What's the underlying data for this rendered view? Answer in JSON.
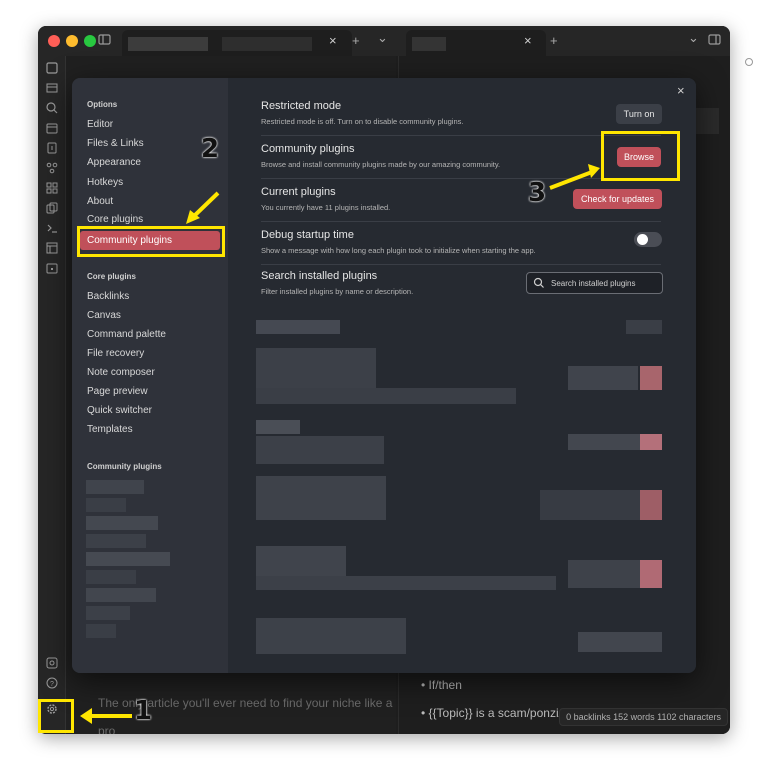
{
  "colors": {
    "accent": "#c0505a",
    "annotation": "#ffe600",
    "modal_bg": "#262a31",
    "sidebar_bg": "#2f323a"
  },
  "settings_sidebar": {
    "options_heading": "Options",
    "options_items": [
      "Editor",
      "Files & Links",
      "Appearance",
      "Hotkeys",
      "About",
      "Core plugins"
    ],
    "active_item": "Community plugins",
    "core_heading": "Core plugins",
    "core_items": [
      "Backlinks",
      "Canvas",
      "Command palette",
      "File recovery",
      "Note composer",
      "Page preview",
      "Quick switcher",
      "Templates"
    ],
    "community_heading": "Community plugins"
  },
  "content": {
    "restricted": {
      "name": "Restricted mode",
      "desc": "Restricted mode is off. Turn on to disable community plugins.",
      "button": "Turn on"
    },
    "community": {
      "name": "Community plugins",
      "desc": "Browse and install community plugins made by our amazing community.",
      "button": "Browse"
    },
    "current": {
      "name": "Current plugins",
      "desc": "You currently have 11 plugins installed.",
      "button": "Check for updates"
    },
    "debug": {
      "name": "Debug startup time",
      "desc": "Show a message with how long each plugin took to initialize when starting the app.",
      "toggle_on": false
    },
    "search": {
      "name": "Search installed plugins",
      "desc": "Filter installed plugins by name or description.",
      "placeholder": "Search installed plugins"
    },
    "close_symbol": "×"
  },
  "background": {
    "note_line_1": "The only article you'll ever need to find your niche like a",
    "note_line_2": "pro",
    "bullet_1": "• If/then",
    "bullet_2": "• {{Topic}} is a scam/ponzi/.... (",
    "status_bar": "0 backlinks   152 words   1102 characters"
  },
  "titlebar": {
    "tab_close": "×",
    "tab_add": "+",
    "tab_menu": "⌄"
  },
  "annotations": [
    "1",
    "2",
    "3"
  ],
  "icons": [
    "sidebar-toggle-icon",
    "folder-icon",
    "search-icon",
    "calendar-icon",
    "graph-icon",
    "canvas-icon",
    "copy-icon",
    "terminal-icon",
    "template-icon",
    "daily-note-icon",
    "vault-icon",
    "help-icon",
    "settings-gear-icon",
    "close-icon"
  ]
}
